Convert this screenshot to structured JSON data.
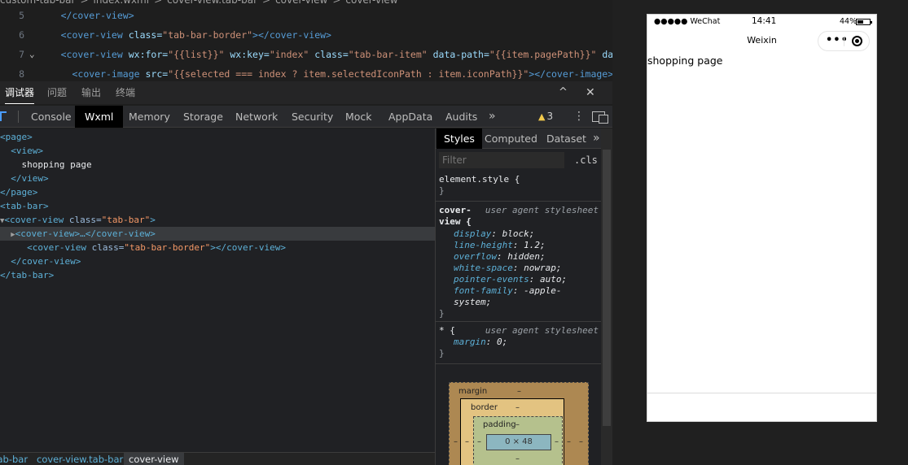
{
  "editor": {
    "breadcrumb": [
      "custom-tab-bar",
      ">",
      "index.wxml",
      ">",
      "cover-view.tab-bar",
      ">",
      "cover-view",
      ">",
      "cover-view"
    ],
    "lines": [
      {
        "num": "5",
        "indent": "  ",
        "parts": [
          {
            "t": "tag",
            "v": "</cover-view>"
          }
        ]
      },
      {
        "num": "6",
        "indent": "  ",
        "parts": [
          {
            "t": "tag",
            "v": "<cover-view"
          },
          {
            "t": "attr",
            "v": " class="
          },
          {
            "t": "str",
            "v": "\"tab-bar-border\""
          },
          {
            "t": "tag",
            "v": "></cover-view>"
          }
        ]
      },
      {
        "num": "7",
        "indent": "  ",
        "parts": [
          {
            "t": "tag",
            "v": "<cover-view"
          },
          {
            "t": "attr",
            "v": " wx:for="
          },
          {
            "t": "str",
            "v": "\"{{list}}\""
          },
          {
            "t": "attr",
            "v": " wx:key="
          },
          {
            "t": "str",
            "v": "\"index\""
          },
          {
            "t": "attr",
            "v": " class="
          },
          {
            "t": "str",
            "v": "\"tab-bar-item\""
          },
          {
            "t": "attr",
            "v": " data-path="
          },
          {
            "t": "str",
            "v": "\"{{item.pagePath}}\""
          },
          {
            "t": "attr",
            "v": " data-ind"
          }
        ]
      },
      {
        "num": "8",
        "indent": "    ",
        "parts": [
          {
            "t": "tag",
            "v": "<cover-image"
          },
          {
            "t": "attr",
            "v": " src="
          },
          {
            "t": "str",
            "v": "\"{{selected === index ? item.selectedIconPath : item.iconPath}}\""
          },
          {
            "t": "tag",
            "v": "></cover-image>"
          }
        ]
      }
    ]
  },
  "panel": {
    "tabs": [
      "调试器",
      "问题",
      "输出",
      "终端"
    ],
    "collapse": "^",
    "close": "✕"
  },
  "devtools": {
    "tabs": [
      "Console",
      "Wxml",
      "Memory",
      "Storage",
      "Network",
      "Security",
      "Mock",
      "AppData",
      "Audits"
    ],
    "more": "»",
    "warnings": "3",
    "menu": "⋮"
  },
  "tree": [
    {
      "type": "tag",
      "v": "<page>"
    },
    {
      "type": "tag",
      "v": "  <view>"
    },
    {
      "type": "text",
      "v": "    shopping page"
    },
    {
      "type": "tag",
      "v": "  </view>"
    },
    {
      "type": "tag",
      "v": "</page>"
    },
    {
      "type": "tag",
      "v": "<tab-bar>"
    },
    {
      "type": "cv",
      "arrow": "▼",
      "pre": "<cover-view",
      "attr": " class=",
      "val": "\"tab-bar\"",
      "post": ">"
    },
    {
      "type": "cvsel",
      "arrow": "▶",
      "v": "<cover-view>…</cover-view>"
    },
    {
      "type": "cv",
      "arrow": "",
      "pre": "    <cover-view",
      "attr": " class=",
      "val": "\"tab-bar-border\"",
      "post": "></cover-view>"
    },
    {
      "type": "tag",
      "v": "  </cover-view>"
    },
    {
      "type": "tag",
      "v": "</tab-bar>"
    }
  ],
  "bottom_breadcrumb": [
    "tab-bar",
    "cover-view.tab-bar",
    "cover-view"
  ],
  "styles": {
    "tabs": [
      "Styles",
      "Computed",
      "Dataset"
    ],
    "more": "»",
    "filter_placeholder": "Filter",
    "cls": ".cls",
    "element_style": "element.style {",
    "close_brace": "}",
    "rule1": {
      "selector": "cover-view {",
      "source": "user agent stylesheet",
      "props": [
        {
          "p": "display",
          "v": "block;"
        },
        {
          "p": "line-height",
          "v": "1.2;"
        },
        {
          "p": "overflow",
          "v": "hidden;"
        },
        {
          "p": "white-space",
          "v": "nowrap;"
        },
        {
          "p": "pointer-events",
          "v": "auto;"
        },
        {
          "p": "font-family",
          "v": "-apple-system;"
        }
      ]
    },
    "rule2": {
      "selector": "* {",
      "source": "user agent stylesheet",
      "props": [
        {
          "p": "margin",
          "v": "0;"
        }
      ]
    },
    "box": {
      "margin": "margin",
      "border": "border",
      "padding": "padding",
      "content": "0 × 48",
      "dash": "–"
    }
  },
  "simulator": {
    "carrier": "●●●●● WeChat",
    "time": "14:41",
    "battery": "44%",
    "nav_title": "Weixin",
    "menu_dots": "•••",
    "page_text": "shopping page"
  }
}
